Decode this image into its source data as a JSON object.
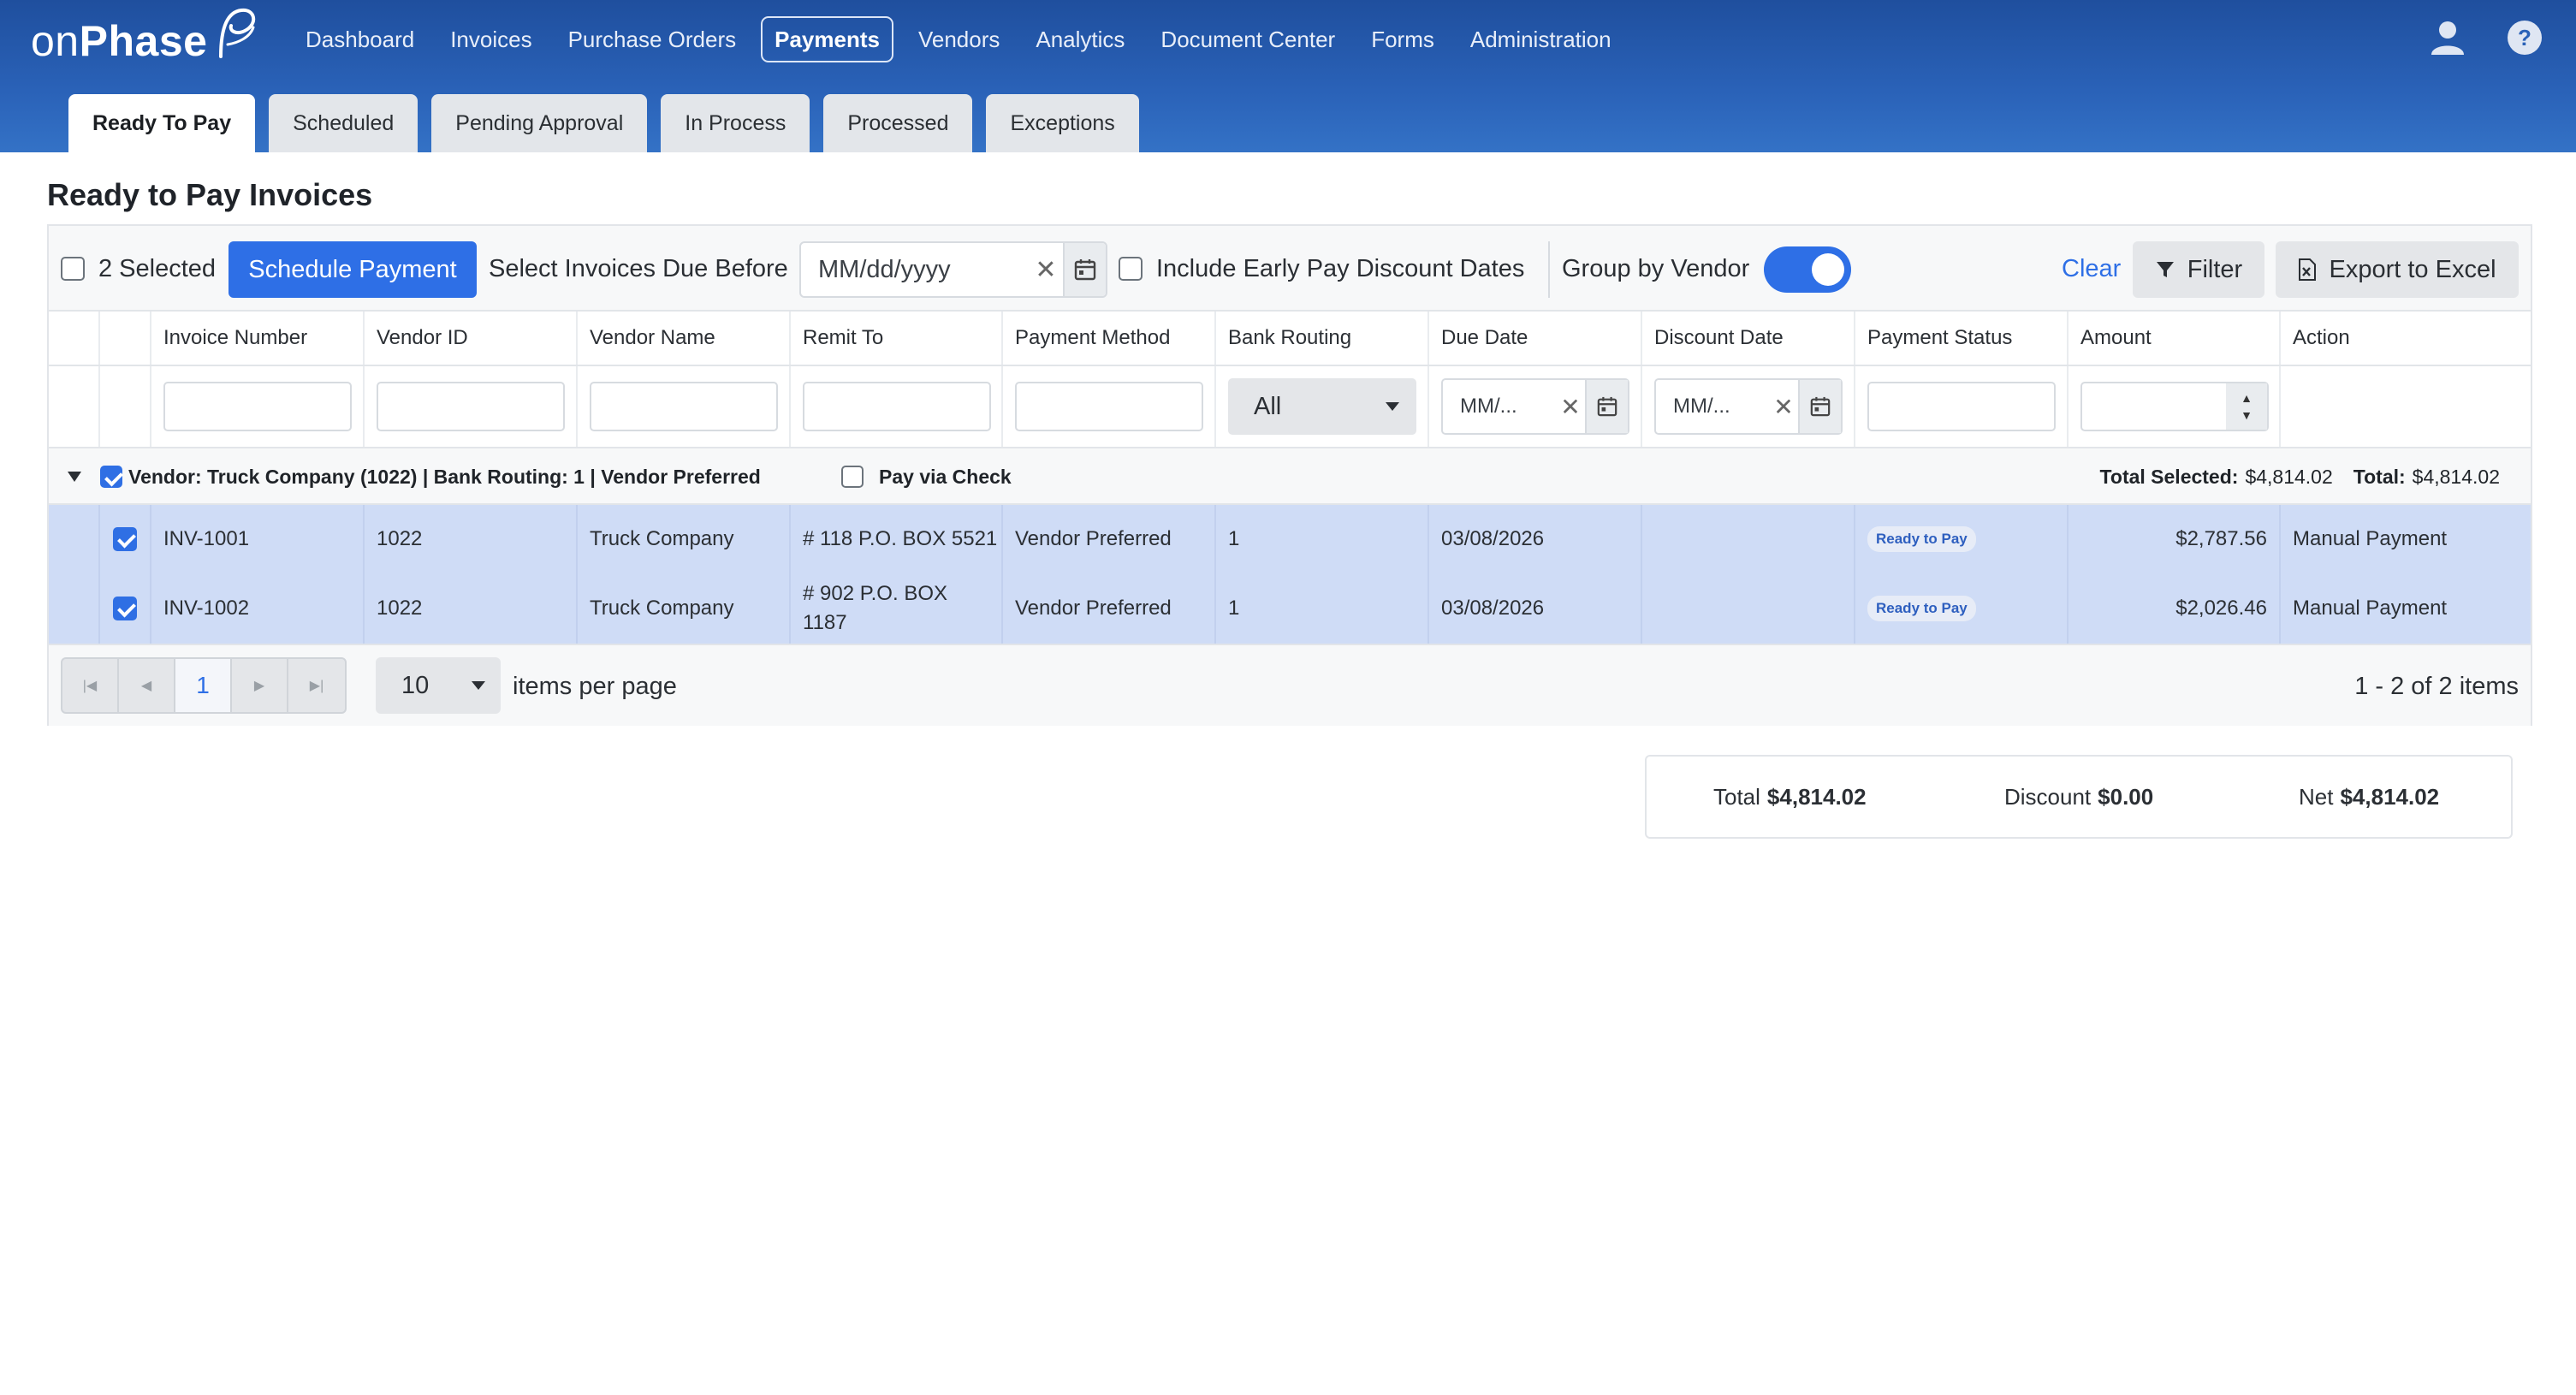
{
  "app": {
    "logo_text_light": "on",
    "logo_text_bold": "Phase"
  },
  "nav": {
    "items": [
      "Dashboard",
      "Invoices",
      "Purchase Orders",
      "Payments",
      "Vendors",
      "Analytics",
      "Document Center",
      "Forms",
      "Administration"
    ],
    "active": "Payments"
  },
  "subtabs": {
    "items": [
      "Ready To Pay",
      "Scheduled",
      "Pending Approval",
      "In Process",
      "Processed",
      "Exceptions"
    ],
    "active": "Ready To Pay"
  },
  "page": {
    "title": "Ready to Pay Invoices"
  },
  "toolbar": {
    "selected_label": "2 Selected",
    "schedule_button": "Schedule Payment",
    "due_before_label": "Select Invoices Due Before",
    "due_before_value": "MM/dd/yyyy",
    "early_pay_label": "Include Early Pay Discount Dates",
    "group_by_label": "Group by Vendor",
    "group_by_on": true,
    "clear_label": "Clear",
    "filter_label": "Filter",
    "export_label": "Export to Excel"
  },
  "table": {
    "columns": [
      "Invoice Number",
      "Vendor ID",
      "Vendor Name",
      "Remit To",
      "Payment Method",
      "Bank Routing",
      "Due Date",
      "Discount Date",
      "Payment Status",
      "Amount",
      "Action"
    ],
    "filters": {
      "bank_routing": "All",
      "due_date": "MM/...",
      "discount_date": "MM/..."
    },
    "group": {
      "label": "Vendor: Truck Company (1022) | Bank Routing: 1 | Vendor Preferred",
      "pay_via_check": "Pay via Check",
      "total_selected_label": "Total Selected:",
      "total_selected_value": "$4,814.02",
      "total_label": "Total:",
      "total_value": "$4,814.02"
    },
    "rows": [
      {
        "invoice": "INV-1001",
        "vendor_id": "1022",
        "vendor_name": "Truck Company",
        "remit_to": "# 118 P.O. BOX 5521",
        "payment_method": "Vendor Preferred",
        "bank_routing": "1",
        "due_date": "03/08/2026",
        "discount_date": "",
        "status": "Ready to Pay",
        "amount": "$2,787.56",
        "action": "Manual Payment"
      },
      {
        "invoice": "INV-1002",
        "vendor_id": "1022",
        "vendor_name": "Truck Company",
        "remit_to": "# 902 P.O. BOX 1187",
        "payment_method": "Vendor Preferred",
        "bank_routing": "1",
        "due_date": "03/08/2026",
        "discount_date": "",
        "status": "Ready to Pay",
        "amount": "$2,026.46",
        "action": "Manual Payment"
      }
    ]
  },
  "pager": {
    "current_page": "1",
    "page_size": "10",
    "per_page_label": "items per page",
    "info": "1 - 2 of 2 items"
  },
  "summary": {
    "total_label": "Total",
    "total_value": "$4,814.02",
    "discount_label": "Discount",
    "discount_value": "$0.00",
    "net_label": "Net",
    "net_value": "$4,814.02"
  },
  "colors": {
    "header_blue": "#2a62b8",
    "accent_blue": "#2e6fe6",
    "selected_row": "#cfdcf6"
  }
}
